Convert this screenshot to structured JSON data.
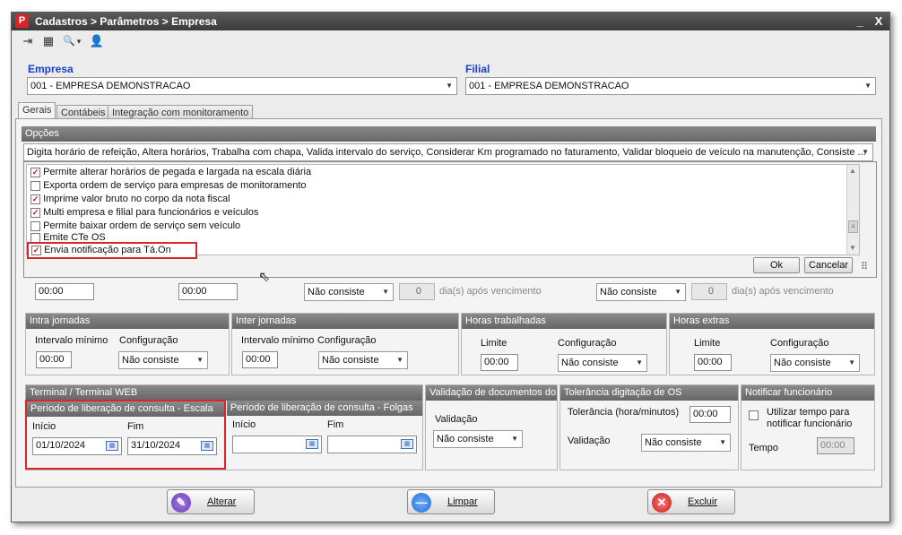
{
  "window": {
    "title": "Cadastros > Parâmetros > Empresa",
    "min": "_",
    "close": "X",
    "logo": "P"
  },
  "toolbar": {
    "icons": [
      "exit-icon",
      "keyboard-icon",
      "search-icon",
      "users-icon"
    ],
    "exit": "⇥",
    "keyboard": "▦",
    "search": "🔍",
    "dropdown": "▾",
    "users": "👤"
  },
  "empresa": {
    "label": "Empresa",
    "value": "001 - EMPRESA DEMONSTRACAO"
  },
  "filial": {
    "label": "Filial",
    "value": "001 - EMPRESA DEMONSTRACAO"
  },
  "tabs": [
    {
      "label": "Gerais"
    },
    {
      "label": "Contábeis"
    },
    {
      "label": "Integração com monitoramento"
    }
  ],
  "opcoes": {
    "header": "Opções",
    "summary": "Digita horário de refeição, Altera horários, Trabalha com chapa, Valida intervalo do serviço, Considerar Km programado no faturamento, Validar bloqueio de veículo na manutenção, Consiste ...",
    "items": [
      {
        "label": "Permite alterar horários de pegada e largada na escala diária",
        "checked": true
      },
      {
        "label": "Exporta ordem de serviço para empresas de monitoramento",
        "checked": false
      },
      {
        "label": "Imprime valor bruto no corpo da nota fiscal",
        "checked": true
      },
      {
        "label": "Multi empresa e filial para funcionários e veículos",
        "checked": true
      },
      {
        "label": "Permite baixar ordem de serviço sem veículo",
        "checked": false
      },
      {
        "label": "Emite CTe OS",
        "checked": false
      },
      {
        "label": "Envia notificação para Tá.On",
        "checked": true
      }
    ],
    "ok": "Ok",
    "cancel": "Cancelar",
    "check_mark": "✓",
    "grip": "⠿"
  },
  "hidden_row": {
    "time1": "00:00",
    "time2": "00:00",
    "sel1": "Não consiste",
    "num1": "0",
    "days1": "dia(s) após vencimento",
    "sel2": "Não consiste",
    "num2": "0",
    "days2": "dia(s) após vencimento"
  },
  "intra": {
    "header": "Intra jornadas",
    "min_label": "Intervalo mínimo",
    "min_value": "00:00",
    "cfg_label": "Configuração",
    "cfg_value": "Não consiste"
  },
  "inter": {
    "header": "Inter jornadas",
    "min_label": "Intervalo mínimo",
    "min_value": "00:00",
    "cfg_label": "Configuração",
    "cfg_value": "Não consiste"
  },
  "horas_trab": {
    "header": "Horas trabalhadas",
    "lim_label": "Limite",
    "lim_value": "00:00",
    "cfg_label": "Configuração",
    "cfg_value": "Não consiste"
  },
  "horas_extra": {
    "header": "Horas extras",
    "lim_label": "Limite",
    "lim_value": "00:00",
    "cfg_label": "Configuração",
    "cfg_value": "Não consiste"
  },
  "terminal": {
    "header": "Terminal / Terminal WEB",
    "escala": {
      "header": "Período de liberação de consulta - Escala",
      "ini_label": "Início",
      "ini_value": "01/10/2024",
      "fim_label": "Fim",
      "fim_value": "31/10/2024"
    },
    "folgas": {
      "header": "Período de liberação de consulta - Folgas",
      "ini_label": "Início",
      "ini_value": "",
      "fim_label": "Fim",
      "fim_value": ""
    }
  },
  "validacao_docs": {
    "header": "Validação de documentos do",
    "label": "Validação",
    "value": "Não consiste"
  },
  "tolerancia": {
    "header": "Tolerância digitação de OS",
    "tol_label": "Tolerância (hora/minutos)",
    "tol_value": "00:00",
    "val_label": "Validação",
    "val_value": "Não consiste"
  },
  "notificar": {
    "header": "Notificar funcionário",
    "chk_label": "Utilizar tempo para notificar funcionário",
    "tempo_label": "Tempo",
    "tempo_value": "00:00"
  },
  "actions": {
    "alterar": "Alterar",
    "limpar": "Limpar",
    "excluir": "Excluir"
  },
  "glyphs": {
    "arrow": "▼",
    "spin_up": "▲",
    "spin_down": "▼",
    "cal": "▦",
    "scroll_up": "▲",
    "scroll_down": "▼",
    "thumb": "≡",
    "alterar_icon": "✎",
    "limpar_icon": "—",
    "excluir_icon": "✕",
    "cursor": "⇖"
  },
  "colors": {
    "accent_label": "#1a3ec8",
    "highlight": "#d9262c",
    "header_bg": "#6f6f6f"
  }
}
